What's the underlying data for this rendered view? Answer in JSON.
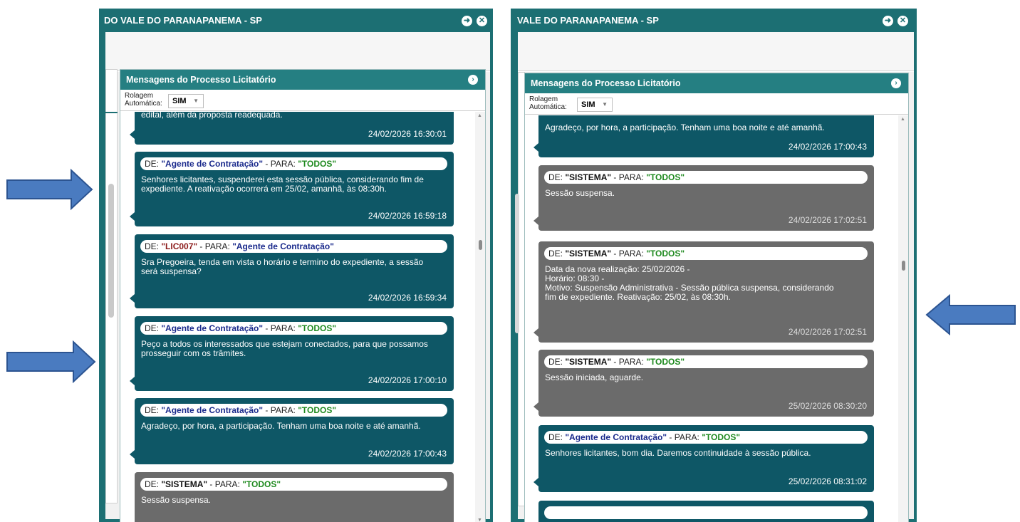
{
  "windows": [
    {
      "title": "DO VALE DO PARANAPANEMA - SP",
      "panel_title": "Mensagens do Processo Licitatório",
      "scroll_label": "Rolagem\nAutomática:",
      "scroll_value": "SIM",
      "partial_top_text": "edital, além da proposta readequada.",
      "partial_top_ts": "24/02/2026 16:30:01",
      "messages": [
        {
          "from": "\"Agente de Contratação\"",
          "to": "\"TODOS\"",
          "text": "Senhores licitantes, suspenderei esta sessão pública, considerando fim de\nexpediente. A reativação ocorrerá em 25/02, amanhã, às 08:30h.",
          "timestamp": "24/02/2026 16:59:18",
          "kind": "user"
        },
        {
          "from": "\"LIC007\"",
          "to": "\"Agente de Contratação\"",
          "text": "Sra Pregoeira, tenda em vista o horário e termino do expediente, a sessão\nserá suspensa?",
          "timestamp": "24/02/2026 16:59:34",
          "kind": "user"
        },
        {
          "from": "\"Agente de Contratação\"",
          "to": "\"TODOS\"",
          "text": "Peço a todos os interessados que estejam conectados, para que possamos\nprosseguir com os trâmites.",
          "timestamp": "24/02/2026 17:00:10",
          "kind": "user"
        },
        {
          "from": "\"Agente de Contratação\"",
          "to": "\"TODOS\"",
          "text": "Agradeço, por hora, a participação. Tenham uma boa noite e até amanhã.",
          "timestamp": "24/02/2026 17:00:43",
          "kind": "user"
        },
        {
          "from": "\"SISTEMA\"",
          "to": "\"TODOS\"",
          "text": "Sessão suspensa.",
          "timestamp": "",
          "kind": "sys"
        }
      ]
    },
    {
      "title": "VALE DO PARANAPANEMA - SP",
      "panel_title": "Mensagens do Processo Licitatório",
      "scroll_label": "Rolagem\nAutomática:",
      "scroll_value": "SIM",
      "partial_top_text": "Agradeço, por hora, a participação. Tenham uma boa noite e até amanhã.",
      "partial_top_ts": "24/02/2026 17:00:43",
      "messages": [
        {
          "from": "\"SISTEMA\"",
          "to": "\"TODOS\"",
          "text": "Sessão suspensa.",
          "timestamp": "24/02/2026 17:02:51",
          "kind": "sys"
        },
        {
          "from": "\"SISTEMA\"",
          "to": "\"TODOS\"",
          "text": "Data da nova realização: 25/02/2026 -\nHorário: 08:30 -\nMotivo: Suspensão Administrativa - Sessão pública suspensa, considerando\nfim de expediente. Reativação: 25/02, às 08:30h.",
          "timestamp": "24/02/2026 17:02:51",
          "kind": "sys"
        },
        {
          "from": "\"SISTEMA\"",
          "to": "\"TODOS\"",
          "text": "Sessão iniciada, aguarde.",
          "timestamp": "25/02/2026 08:30:20",
          "kind": "sys"
        },
        {
          "from": "\"Agente de Contratação\"",
          "to": "\"TODOS\"",
          "text": "Senhores licitantes, bom dia. Daremos continuidade à sessão pública.",
          "timestamp": "25/02/2026 08:31:02",
          "kind": "user"
        }
      ]
    }
  ],
  "header_prefix_from": "DE: ",
  "header_prefix_to": " - PARA: ",
  "colors": {
    "window": "#1c6f73",
    "panel_header": "#257f82",
    "user_bubble": "#0e5766",
    "system_bubble": "#6b6b6b",
    "arrow_fill": "#4a7bc0",
    "arrow_stroke": "#2c5491"
  },
  "icons": {
    "maximize": "circle-arrow-icon",
    "close": "circle-x-icon",
    "panel_go": "chevron-right-circle-icon",
    "annotation": "block-arrow"
  }
}
